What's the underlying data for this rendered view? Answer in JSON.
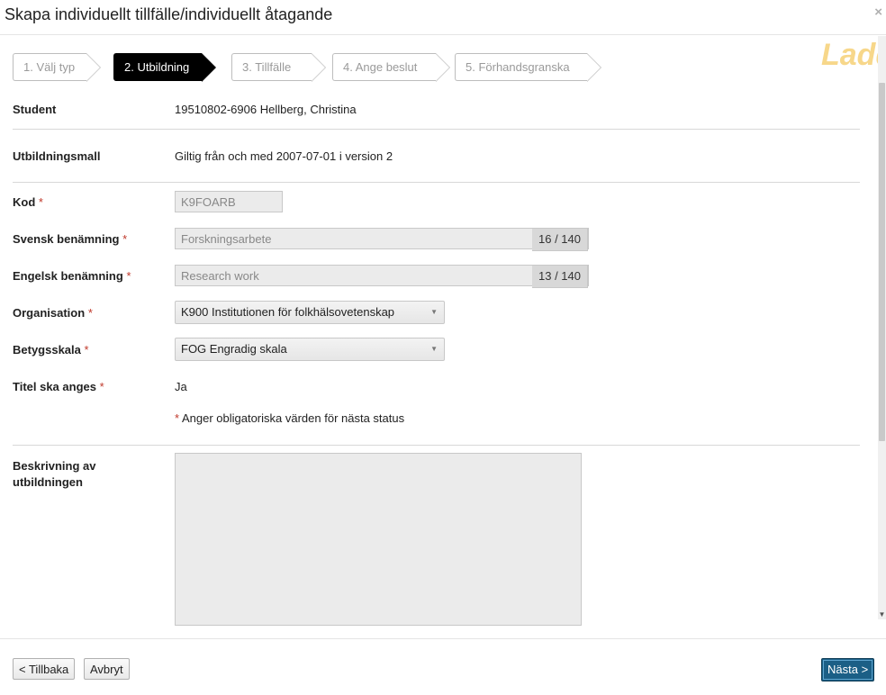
{
  "dialog": {
    "title": "Skapa individuellt tillfälle/individuellt åtagande",
    "close_glyph": "×",
    "loading_text": "Laddar"
  },
  "steps": [
    {
      "label": "1. Välj typ",
      "active": false
    },
    {
      "label": "2. Utbildning",
      "active": true
    },
    {
      "label": "3. Tillfälle",
      "active": false
    },
    {
      "label": "4. Ange beslut",
      "active": false
    },
    {
      "label": "5. Förhandsgranska",
      "active": false
    }
  ],
  "form": {
    "student_label": "Student",
    "student_value": "19510802-6906 Hellberg, Christina",
    "template_label": "Utbildningsmall",
    "template_value": "Giltig från och med 2007-07-01 i version 2",
    "code_label": "Kod",
    "code_value": "K9FOARB",
    "swedish_label": "Svensk benämning",
    "swedish_value": "Forskningsarbete",
    "swedish_counter": "16 / 140",
    "english_label": "Engelsk benämning",
    "english_value": "Research work",
    "english_counter": "13 / 140",
    "org_label": "Organisation",
    "org_value": "K900 Institutionen för folkhälsovetenskap",
    "grade_label": "Betygsskala",
    "grade_value": "FOG Engradig skala",
    "title_label": "Titel ska anges",
    "title_value": "Ja",
    "required_mark": "*",
    "required_note": "Anger obligatoriska värden för nästa status",
    "description_label_1": "Beskrivning av",
    "description_label_2": "utbildningen"
  },
  "footer": {
    "back_label": "< Tillbaka",
    "cancel_label": "Avbryt",
    "next_label": "Nästa >"
  },
  "colors": {
    "primary": "#1b5f86",
    "required": "#c0392b",
    "active_step": "#000000"
  }
}
